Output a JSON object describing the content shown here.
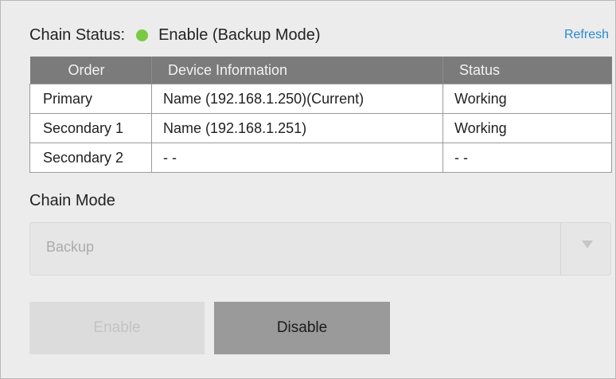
{
  "chain_status": {
    "label": "Chain Status:",
    "state": "Enable (Backup Mode)",
    "indicator_color": "#7ac943",
    "refresh_label": "Refresh"
  },
  "table": {
    "headers": [
      "Order",
      "Device Information",
      "Status"
    ],
    "rows": [
      {
        "order": "Primary",
        "device": "Name (192.168.1.250)(Current)",
        "status": "Working"
      },
      {
        "order": "Secondary 1",
        "device": "Name (192.168.1.251)",
        "status": "Working"
      },
      {
        "order": "Secondary 2",
        "device": "- -",
        "status": "- -"
      }
    ]
  },
  "chain_mode": {
    "label": "Chain Mode",
    "selected": "Backup"
  },
  "buttons": {
    "enable_label": "Enable",
    "enable_disabled": true,
    "disable_label": "Disable"
  },
  "colors": {
    "accent_link": "#2a8ad2",
    "header_bg": "#7b7b7b",
    "status_ok": "#7ac943"
  }
}
